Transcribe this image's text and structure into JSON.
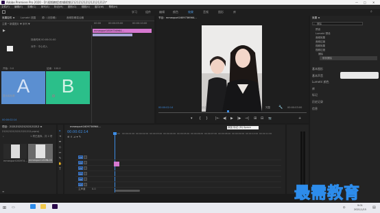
{
  "app": {
    "title": "Adobe Premiere Pro 2020 - D:\\视频教程\\剪辑视频\\2121212121212121212\\*",
    "menus": [
      "文件(F)",
      "编辑(E)",
      "剪辑(C)",
      "序列(S)",
      "标记(M)",
      "图形(G)",
      "视图(V)",
      "窗口(W)",
      "帮助(H)"
    ],
    "window_controls": [
      "—",
      "□",
      "✕"
    ]
  },
  "workspaces": [
    "学习",
    "组件",
    "编辑",
    "颜色",
    "效果",
    "音频",
    "图形",
    "库"
  ],
  "active_workspace": "效果",
  "effect_controls": {
    "tabs": [
      "效果控件 ≡",
      "Lumetri 范围",
      "源：(无剪辑)",
      "音频剪辑混合器"
    ],
    "source_label": "主要 * 新建图片 ▼ 序列 ▼",
    "ruler": [
      "00:00",
      "00:00:05:00",
      "00:00:10:00"
    ],
    "clip_name": "mmexport1609736964...",
    "transition_name": "带状擦除",
    "row_labels": [
      "持续时间 00:00:01:00",
      "对齐：中心切入"
    ],
    "start_label": "开始：0.0",
    "end_label": "结束：100.0",
    "preview_a": "A",
    "preview_b": "B",
    "reverse_label": "显示实际源",
    "reverse2_label": "反向",
    "timecode": "00:00:02:14"
  },
  "program_monitor": {
    "tab": "节目：mmexport1609736964...",
    "timecode_left": "00:00:02:14",
    "fit": "适合",
    "quality": "完整",
    "timecode_right": "00:00:03:00",
    "controls": [
      "▾",
      "{",
      "}",
      "|←",
      "◀|",
      "▶",
      "|▶",
      "→|",
      "⊞",
      "⊟",
      "📷",
      "+"
    ]
  },
  "project_panel": {
    "tab": "项目：2121212121212121212 ≡",
    "sub": "2121212121212121212.prproj",
    "items_count": "1 项已选择，共 2 项",
    "thumb1_label": "mmexport160974...",
    "thumb2_label": "mmexport1609...",
    "thumb2_dur": "5:00",
    "search": "⌕"
  },
  "effects_panel": {
    "tab": "效果 ≡",
    "search_placeholder": "擦除",
    "tree": [
      "预设",
      "Lumetri 预设",
      "音频效果",
      "音频过渡",
      "视频效果",
      "视频过渡",
      "擦除",
      "带状擦除"
    ],
    "sections": [
      "基本图形",
      "基本声音",
      "Lumetri 颜色",
      "库",
      "标记",
      "历史记录",
      "信息"
    ]
  },
  "timeline": {
    "tab": "mmexport1609736964...",
    "timecode": "00:00:02:14",
    "tooltip": "添加 标记 (M)  Space",
    "ruler": [
      "00:00",
      "00:00:01:00",
      "00:00:02:00",
      "00:00:03:00",
      "00:00:04:00",
      "00:00:05:00",
      "00:00:06:00",
      "00:00:07:00",
      "00:00:08:00",
      "00:00:09:00",
      "00:00:10:00",
      "00:00:11:00",
      "00:00:12:00",
      "00:00:13:00"
    ],
    "tracks": [
      "V3",
      "V2",
      "V1",
      "A1",
      "A2",
      "A3"
    ],
    "master_label": "主声道",
    "master_value": "0.0"
  },
  "taskbar": {
    "time": "9:01",
    "date": "2021/1/15",
    "lang": "中"
  },
  "watermark": "最需教育",
  "colors": {
    "accent_blue": "#2d8ceb",
    "timecode_blue": "#3d8ee6",
    "clip_pink": "#d678d0",
    "preview_a": "#5b8fd1",
    "preview_b": "#2bbf8a"
  }
}
